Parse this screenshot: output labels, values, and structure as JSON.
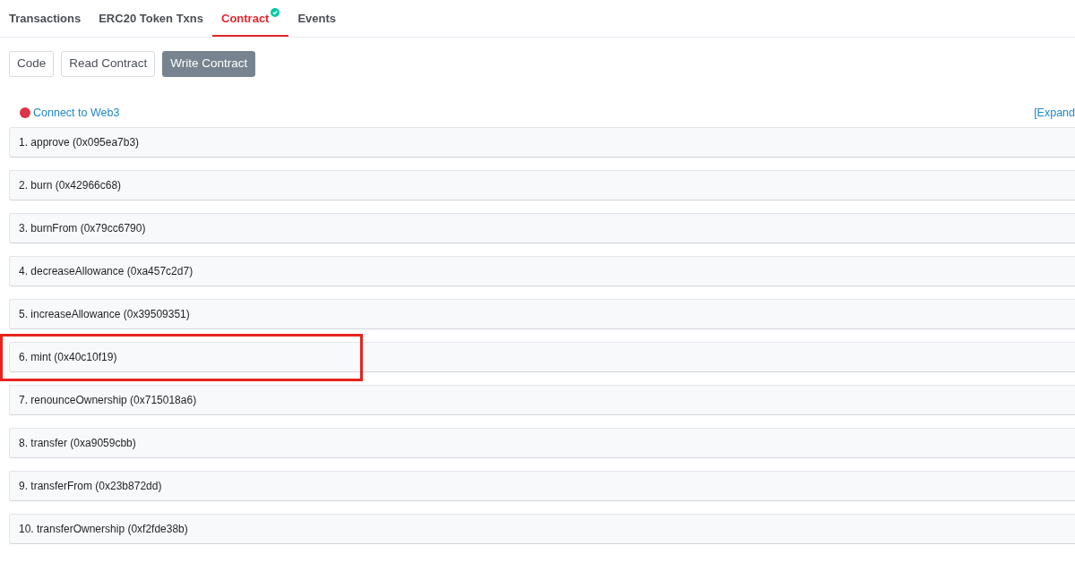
{
  "tabs": [
    {
      "label": "Transactions",
      "selected": false,
      "verified": false
    },
    {
      "label": "ERC20 Token Txns",
      "selected": false,
      "verified": false
    },
    {
      "label": "Contract",
      "selected": true,
      "verified": true
    },
    {
      "label": "Events",
      "selected": false,
      "verified": false
    }
  ],
  "subtabs": [
    {
      "label": "Code",
      "selected": false
    },
    {
      "label": "Read Contract",
      "selected": false
    },
    {
      "label": "Write Contract",
      "selected": true
    }
  ],
  "connect": {
    "label": "Connect to Web3",
    "color": "#dc3545"
  },
  "expand_link": "[Expand",
  "functions": [
    {
      "label": "1. approve (0x095ea7b3)",
      "highlighted": false
    },
    {
      "label": "2. burn (0x42966c68)",
      "highlighted": false
    },
    {
      "label": "3. burnFrom (0x79cc6790)",
      "highlighted": false
    },
    {
      "label": "4. decreaseAllowance (0xa457c2d7)",
      "highlighted": false
    },
    {
      "label": "5. increaseAllowance (0x39509351)",
      "highlighted": false
    },
    {
      "label": "6. mint (0x40c10f19)",
      "highlighted": true
    },
    {
      "label": "7. renounceOwnership (0x715018a6)",
      "highlighted": false
    },
    {
      "label": "8. transfer (0xa9059cbb)",
      "highlighted": false
    },
    {
      "label": "9. transferFrom (0x23b872dd)",
      "highlighted": false
    },
    {
      "label": "10. transferOwnership (0xf2fde38b)",
      "highlighted": false
    }
  ]
}
